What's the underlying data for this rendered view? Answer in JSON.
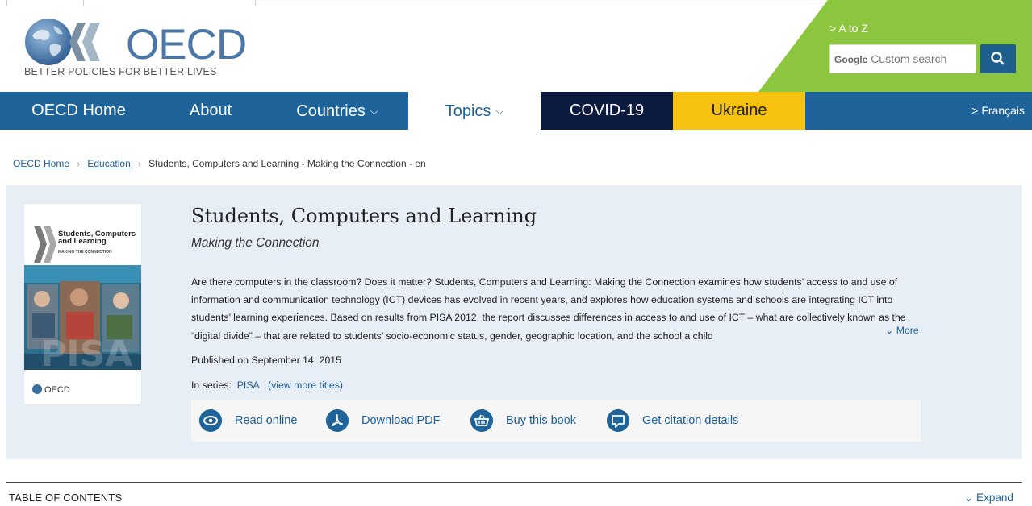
{
  "header": {
    "logo_text": "OECD",
    "tagline": "BETTER POLICIES FOR BETTER LIVES",
    "a_to_z": "> A to Z",
    "search_brand": "Google",
    "search_placeholder": "Custom search",
    "search_button_icon": "search-icon"
  },
  "nav": {
    "items": [
      {
        "label": "OECD Home",
        "has_dropdown": false
      },
      {
        "label": "About",
        "has_dropdown": false
      },
      {
        "label": "Countries",
        "has_dropdown": true
      },
      {
        "label": "Topics",
        "has_dropdown": true
      },
      {
        "label": "COVID-19",
        "has_dropdown": false
      },
      {
        "label": "Ukraine",
        "has_dropdown": false
      }
    ],
    "language": "> Français",
    "dropdown_glyph": "⌵"
  },
  "breadcrumb": {
    "items": [
      "OECD Home",
      "Education"
    ],
    "current": "Students, Computers and Learning - Making the Connection - en",
    "separator": "›"
  },
  "book": {
    "cover_title": "Students, Computers and Learning",
    "cover_subtitle": "MAKING THE CONNECTION",
    "cover_logo": "OECD",
    "title": "Students, Computers and Learning",
    "subtitle": "Making the Connection",
    "abstract": "Are there computers in the classroom? Does it matter? Students, Computers and Learning: Making the Connection examines how students’ access to and use of information and communication technology (ICT) devices has evolved in recent years, and explores how education systems and schools are integrating ICT into students’ learning experiences. Based on results from PISA 2012, the report discusses differences in access to and use of ICT – what are collectively known as the “digital divide” – that are related to students’ socio-economic status, gender, geographic location, and the school a child",
    "more_label": "⌄ More",
    "published": "Published on September 14, 2015",
    "series_label": "In series:",
    "series_name": "PISA",
    "view_more": "(view more titles)",
    "actions": [
      {
        "label": "Read online",
        "icon": "eye-icon"
      },
      {
        "label": "Download PDF",
        "icon": "pdf-icon"
      },
      {
        "label": "Buy this book",
        "icon": "basket-icon"
      },
      {
        "label": "Get citation details",
        "icon": "quote-icon"
      }
    ]
  },
  "toc": {
    "title": "TABLE OF CONTENTS",
    "expand_label": "⌄ Expand"
  },
  "colors": {
    "nav_blue": "#1e6399",
    "covid_bg": "#0b1a3e",
    "ukraine_bg": "#f6c20f",
    "header_green": "#8cc63e",
    "panel_bg": "#e7eef5",
    "link_blue": "#1e5f99"
  }
}
